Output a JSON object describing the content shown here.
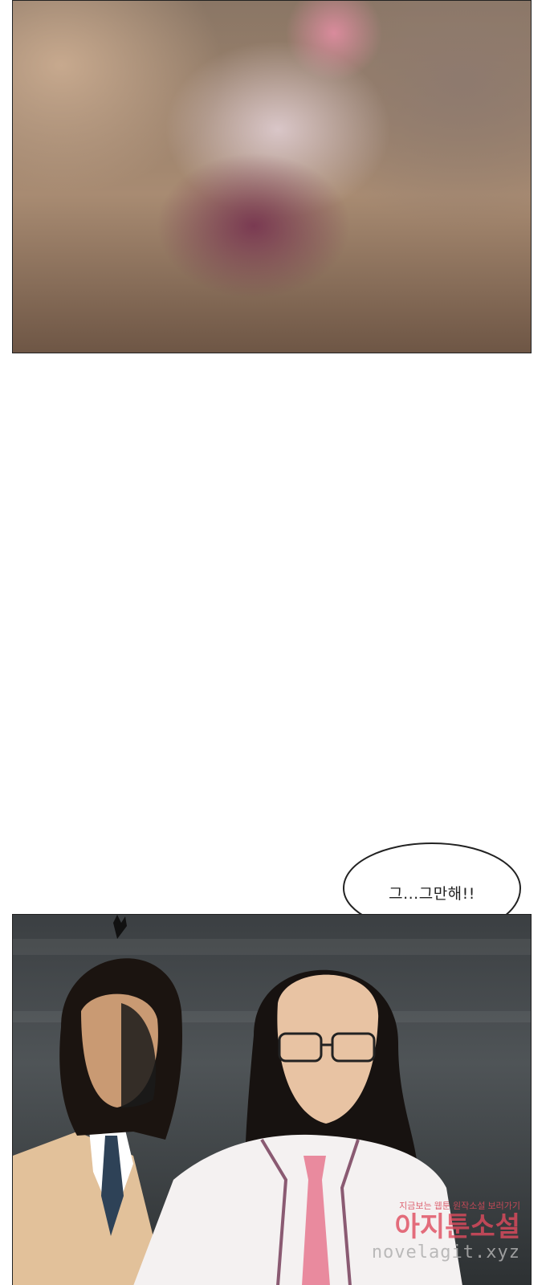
{
  "speech_bubble": {
    "text": "그...그만해!!"
  },
  "watermark": {
    "line1": "지금보는 웹툰 원작소설 보러가기",
    "line2": "아지툰소설",
    "line3": "novelagit.xyz"
  },
  "colors": {
    "watermark_red": "#e04b5e",
    "panel_border": "#222222",
    "background": "#ffffff"
  }
}
